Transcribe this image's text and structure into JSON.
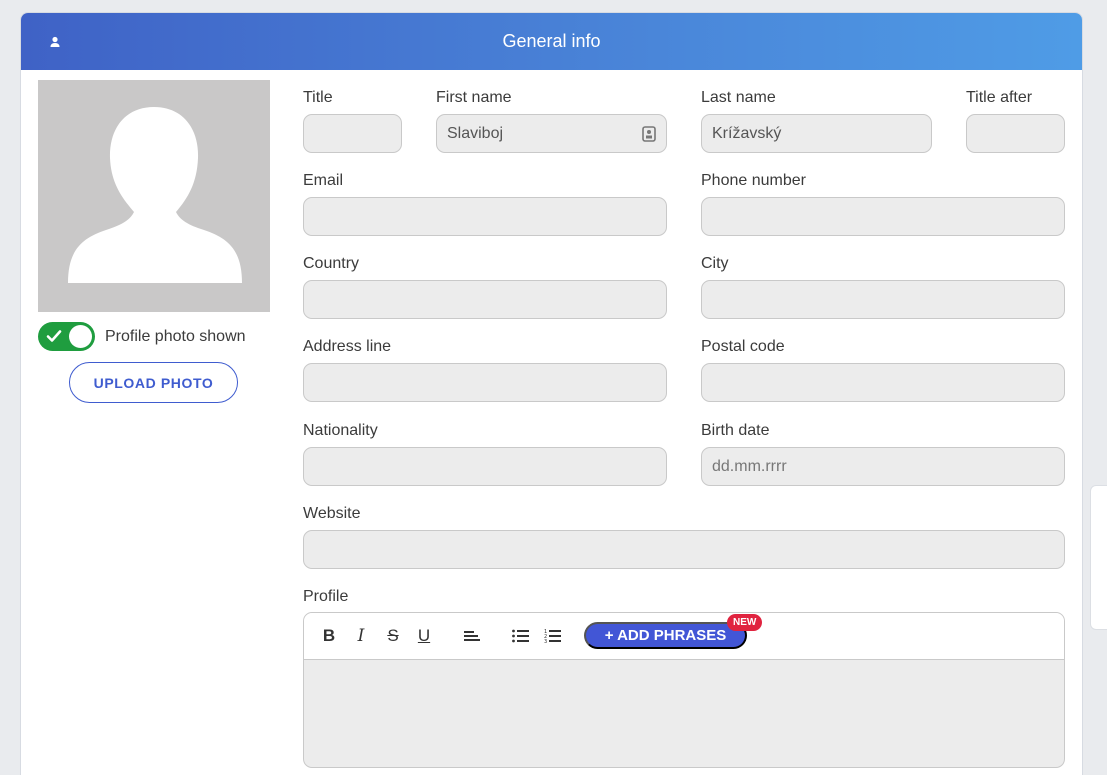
{
  "header": {
    "title": "General info",
    "icon": "user-icon"
  },
  "photo": {
    "toggle_label": "Profile photo shown",
    "toggle_on": true,
    "upload_label": "UPLOAD PHOTO"
  },
  "fields": {
    "title": {
      "label": "Title",
      "value": ""
    },
    "first_name": {
      "label": "First name",
      "value": "Slaviboj"
    },
    "last_name": {
      "label": "Last name",
      "value": "Krížavský"
    },
    "title_after": {
      "label": "Title after",
      "value": ""
    },
    "email": {
      "label": "Email",
      "value": ""
    },
    "phone": {
      "label": "Phone number",
      "value": ""
    },
    "country": {
      "label": "Country",
      "value": ""
    },
    "city": {
      "label": "City",
      "value": ""
    },
    "address": {
      "label": "Address line",
      "value": ""
    },
    "postal": {
      "label": "Postal code",
      "value": ""
    },
    "nationality": {
      "label": "Nationality",
      "value": ""
    },
    "birth_date": {
      "label": "Birth date",
      "placeholder": "dd.mm.rrrr"
    },
    "website": {
      "label": "Website",
      "value": ""
    }
  },
  "profile": {
    "label": "Profile",
    "toolbar": {
      "bold": "B",
      "italic": "I",
      "strike": "S",
      "underline": "U"
    },
    "add_phrases": "+ ADD PHRASES",
    "badge": "NEW"
  },
  "colors": {
    "accent": "#3f5ccf",
    "header_start": "#3f62c6",
    "header_end": "#4f9ce6",
    "toggle": "#1f9d3f",
    "badge": "#e0233f"
  }
}
